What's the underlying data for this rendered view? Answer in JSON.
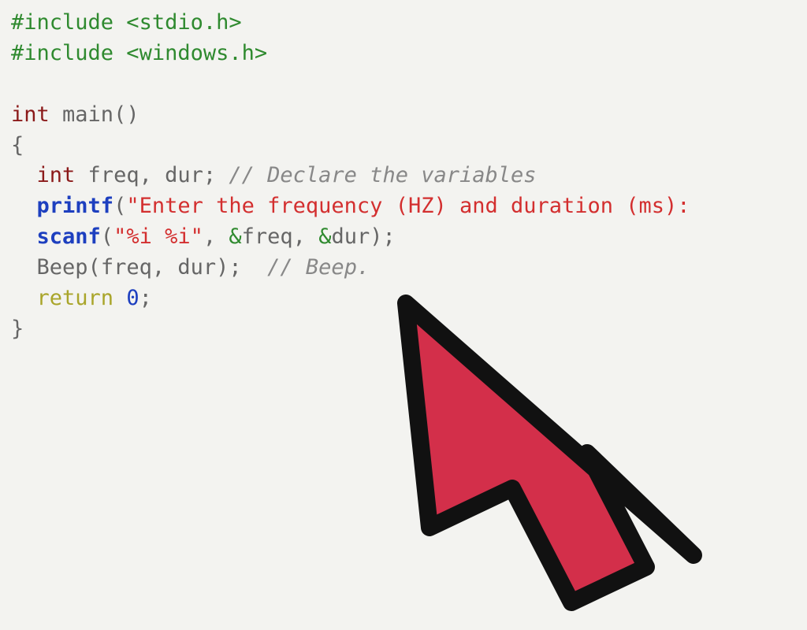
{
  "code": {
    "line1_include": "#include",
    "line1_hdr_open": " <",
    "line1_hdr": "stdio.h",
    "line1_hdr_close": ">",
    "line2_include": "#include",
    "line2_hdr_open": " <",
    "line2_hdr": "windows.h",
    "line2_hdr_close": ">",
    "line4_type": "int",
    "line4_main": " main",
    "line4_parens": "()",
    "line5_brace": "{",
    "line6_indent": "  ",
    "line6_type": "int",
    "line6_vars": " freq, dur; ",
    "line6_comment": "// Declare the variables",
    "line7_indent": "  ",
    "line7_printf": "printf",
    "line7_open": "(",
    "line7_str": "\"Enter the frequency (HZ) and duration (ms):",
    "line8_indent": "  ",
    "line8_scanf": "scanf",
    "line8_open": "(",
    "line8_fmt": "\"%i %i\"",
    "line8_comma1": ", ",
    "line8_amp1": "&",
    "line8_arg1": "freq",
    "line8_comma2": ", ",
    "line8_amp2": "&",
    "line8_arg2": "dur",
    "line8_close": ");",
    "line9_indent": "  ",
    "line9_beep": "Beep",
    "line9_open": "(",
    "line9_args": "freq, dur",
    "line9_close": ");  ",
    "line9_comment": "// Beep.",
    "line10_indent": "  ",
    "line10_return": "return",
    "line10_sp": " ",
    "line10_zero": "0",
    "line10_semi": ";",
    "line11_brace": "}"
  },
  "cursor_fill": "#d32f4a",
  "cursor_stroke": "#111111"
}
